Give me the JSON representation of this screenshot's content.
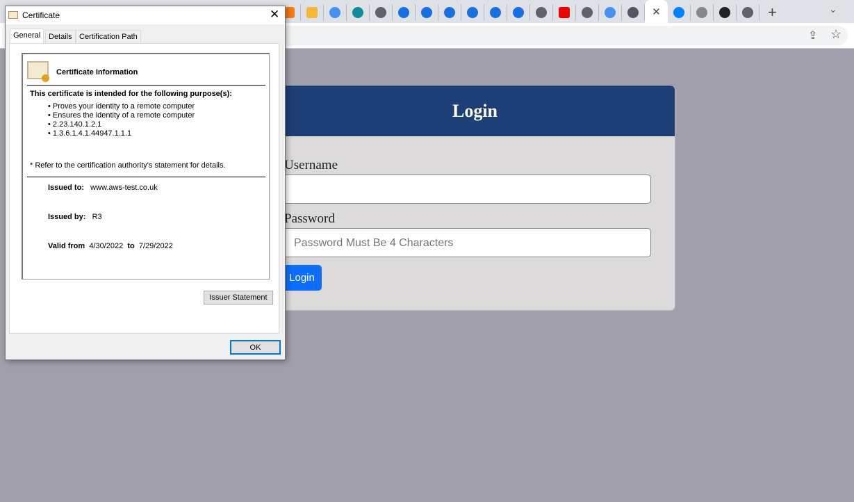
{
  "browser": {
    "tabs": [
      {
        "icon": "orange-box-icon",
        "color": "#f07d1a"
      },
      {
        "icon": "yellow-box-icon",
        "color": "#f5b83d"
      },
      {
        "icon": "search-q-icon",
        "color": "#4a8ff0"
      },
      {
        "icon": "home-icon",
        "color": "#118a9a"
      },
      {
        "icon": "globe-icon",
        "color": "#5f6368"
      },
      {
        "icon": "app-drop-icon",
        "color": "#1a6fe0"
      },
      {
        "icon": "app-drop-icon",
        "color": "#1a6fe0"
      },
      {
        "icon": "app-drop-icon",
        "color": "#1a6fe0"
      },
      {
        "icon": "app-drop-icon",
        "color": "#1a6fe0"
      },
      {
        "icon": "app-drop-icon",
        "color": "#1a6fe0"
      },
      {
        "icon": "app-drop-icon",
        "color": "#1a6fe0"
      },
      {
        "icon": "globe-icon",
        "color": "#5f6368"
      },
      {
        "icon": "youtube-icon",
        "color": "#e00"
      },
      {
        "icon": "globe-icon",
        "color": "#5f6368"
      },
      {
        "icon": "search-q-icon",
        "color": "#4a8ff0"
      },
      {
        "icon": "scan-icon",
        "color": "#556"
      },
      {
        "icon": "active-tab-close-icon",
        "color": "#444"
      },
      {
        "icon": "digitalocean-icon",
        "color": "#0080ff"
      },
      {
        "icon": "robot-icon",
        "color": "#888"
      },
      {
        "icon": "github-icon",
        "color": "#222"
      },
      {
        "icon": "globe-icon",
        "color": "#5f6368"
      }
    ],
    "new_tab": "+",
    "tab_menu": "⌄",
    "active_close": "✕"
  },
  "login": {
    "title": "Login",
    "username_label": "Username",
    "username_value": "",
    "password_label": "Password",
    "password_placeholder": "Password Must Be 4 Characters",
    "button": "Login",
    "header_color": "#1d3f76",
    "button_color": "#0d6efd"
  },
  "dialog": {
    "title": "Certificate",
    "tabs": [
      "General",
      "Details",
      "Certification Path"
    ],
    "heading": "Certificate Information",
    "purpose_heading": "This certificate is intended for the following purpose(s):",
    "purposes": [
      "Proves your identity to a remote computer",
      "Ensures the identity of a remote computer",
      "2.23.140.1.2.1",
      "1.3.6.1.4.1.44947.1.1.1"
    ],
    "note": "Refer to the certification authority's statement for details.",
    "issued_to_label": "Issued to:",
    "issued_to": "www.aws-test.co.uk",
    "issued_by_label": "Issued by:",
    "issued_by": "R3",
    "valid_from_label": "Valid from",
    "valid_from": "4/30/2022",
    "to_label": "to",
    "valid_to": "7/29/2022",
    "issuer_statement": "Issuer Statement",
    "ok": "OK"
  }
}
